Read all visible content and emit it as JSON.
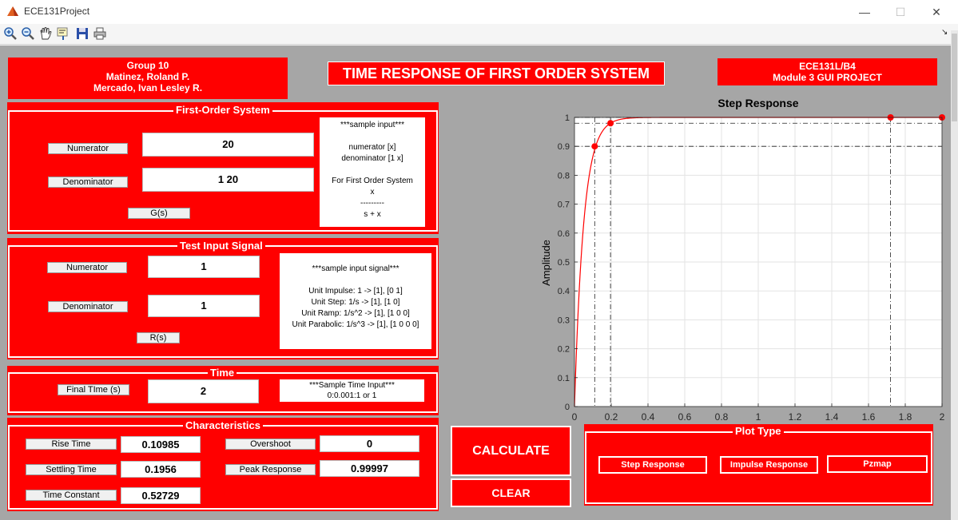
{
  "window": {
    "title": "ECE131Project",
    "minimize": "—",
    "maximize": "☐",
    "close": "✕"
  },
  "toolbar": {
    "icons": [
      "zoom-in-icon",
      "zoom-out-icon",
      "pan-icon",
      "data-cursor-icon",
      "save-icon",
      "print-icon"
    ]
  },
  "header": {
    "group": [
      "Group 10",
      "Matinez, Roland P.",
      "Mercado, Ivan Lesley R."
    ],
    "title": "TIME RESPONSE OF FIRST ORDER SYSTEM",
    "course": [
      "ECE131L/B4",
      "Module 3 GUI PROJECT"
    ]
  },
  "first_order": {
    "title": "First-Order System",
    "num_label": "Numerator",
    "num_value": "20",
    "den_label": "Denominator",
    "den_value": "1 20",
    "gs_label": "G(s)",
    "sample": [
      "***sample input***",
      "",
      "numerator     [x]",
      "denominator [1 x]",
      "",
      "For First Order System",
      "x",
      "---------",
      "s   +  x"
    ]
  },
  "test_input": {
    "title": "Test Input Signal",
    "num_label": "Numerator",
    "num_value": "1",
    "den_label": "Denominator",
    "den_value": "1",
    "rs_label": "R(s)",
    "sample": [
      "***sample input signal***",
      "",
      "Unit Impulse: 1 -> [1], [0 1]",
      "Unit Step: 1/s -> [1], [1 0]",
      "Unit Ramp: 1/s^2 -> [1], [1 0 0]",
      "Unit Parabolic: 1/s^3 -> [1], [1 0 0 0]"
    ]
  },
  "time": {
    "title": "Time",
    "label": "Final TIme (s)",
    "value": "2",
    "sample": [
      "***Sample Time Input***",
      "0:0.001:1 or 1"
    ]
  },
  "characteristics": {
    "title": "Characteristics",
    "rise_label": "Rise Time",
    "rise_value": "0.10985",
    "settling_label": "Settling Time",
    "settling_value": "0.1956",
    "tc_label": "Time Constant",
    "tc_value": "0.52729",
    "overshoot_label": "Overshoot",
    "overshoot_value": "0",
    "peak_label": "Peak Response",
    "peak_value": "0.99997"
  },
  "buttons": {
    "calculate": "CALCULATE",
    "clear": "CLEAR"
  },
  "plot_type": {
    "title": "Plot Type",
    "step": "Step Response",
    "impulse": "Impulse Response",
    "pzmap": "Pzmap"
  },
  "chart_data": {
    "type": "line",
    "title": "Step Response",
    "ylabel": "Amplitude",
    "xlabel": "",
    "xlim": [
      0,
      2
    ],
    "ylim": [
      0,
      1
    ],
    "xticks": [
      "0",
      "0.2",
      "0.4",
      "0.6",
      "0.8",
      "1",
      "1.2",
      "1.4",
      "1.6",
      "1.8",
      "2"
    ],
    "yticks": [
      "0",
      "0.1",
      "0.2",
      "0.3",
      "0.4",
      "0.5",
      "0.6",
      "0.7",
      "0.8",
      "0.9",
      "1"
    ],
    "grid": true,
    "series": [
      {
        "tau": 0.05,
        "final": 1,
        "color": "#ff0000"
      }
    ],
    "markers": [
      {
        "x": 0.11,
        "y": 0.9
      },
      {
        "x": 0.196,
        "y": 0.98
      },
      {
        "x": 1.72,
        "y": 1.0
      },
      {
        "x": 2.0,
        "y": 1.0
      }
    ],
    "ref_lines": {
      "h": [
        0.9,
        0.98,
        1.0
      ],
      "v": [
        0.11,
        0.196,
        1.72
      ]
    }
  }
}
